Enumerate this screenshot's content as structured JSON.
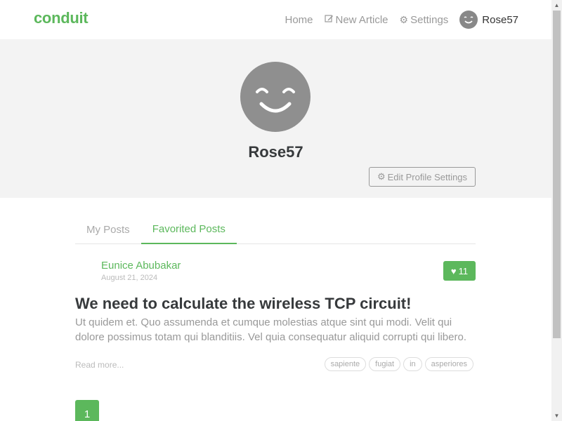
{
  "navbar": {
    "brand": "conduit",
    "items": [
      {
        "label": "Home",
        "icon": ""
      },
      {
        "label": "New Article",
        "icon": "edit-icon"
      },
      {
        "label": "Settings",
        "icon": "gear-icon"
      },
      {
        "label": "Rose57",
        "icon": "avatar"
      }
    ]
  },
  "profile": {
    "username": "Rose57",
    "edit_label": "Edit Profile Settings"
  },
  "tabs": [
    {
      "label": "My Posts",
      "active": false
    },
    {
      "label": "Favorited Posts",
      "active": true
    }
  ],
  "article": {
    "author": "Eunice Abubakar",
    "date": "August 21, 2024",
    "favorites": "11",
    "title": "We need to calculate the wireless TCP circuit!",
    "description": "Ut quidem et. Quo assumenda et cumque molestias atque sint qui modi. Velit qui dolore possimus totam qui blanditiis. Vel quia consequatur aliquid corrupti qui libero.",
    "read_more": "Read more...",
    "tags": [
      "sapiente",
      "fugiat",
      "in",
      "asperiores"
    ]
  },
  "pagination": {
    "current": "1"
  },
  "colors": {
    "accent": "#5cb85c",
    "banner": "#f3f3f3",
    "avatar": "#8f8f8f"
  }
}
